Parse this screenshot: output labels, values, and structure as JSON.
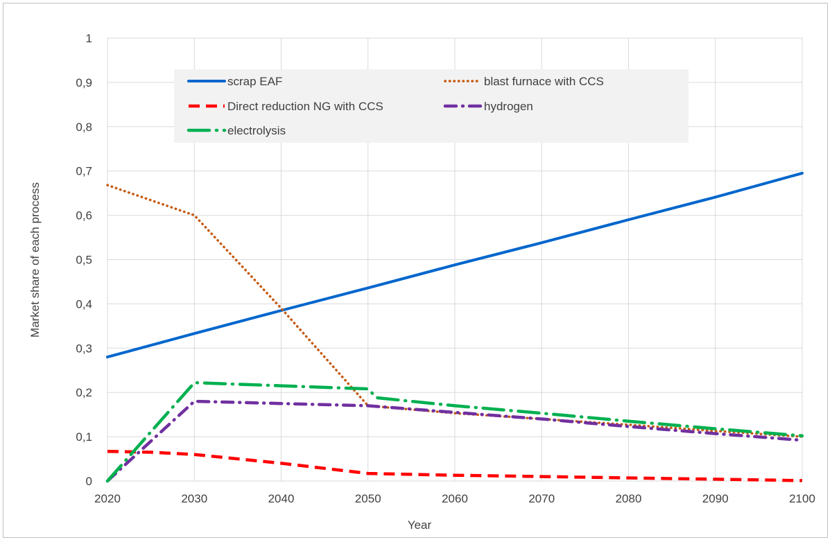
{
  "chart_data": {
    "type": "line",
    "title": "",
    "xlabel": "Year",
    "ylabel": "Market share of each process",
    "xlim": [
      2020,
      2100
    ],
    "ylim": [
      0,
      1
    ],
    "x_ticks": [
      "2020",
      "2030",
      "2040",
      "2050",
      "2060",
      "2070",
      "2080",
      "2090",
      "2100"
    ],
    "y_ticks": [
      "0",
      "0,1",
      "0,2",
      "0,3",
      "0,4",
      "0,5",
      "0,6",
      "0,7",
      "0,8",
      "0,9",
      "1"
    ],
    "grid": "vertical and horizontal",
    "legend_position": "top-left inside",
    "series": [
      {
        "name": "scrap EAF",
        "color": "#0066cc",
        "style": "solid",
        "points": [
          [
            2020,
            0.28
          ],
          [
            2030,
            0.333
          ],
          [
            2040,
            0.385
          ],
          [
            2050,
            0.436
          ],
          [
            2060,
            0.488
          ],
          [
            2070,
            0.538
          ],
          [
            2080,
            0.59
          ],
          [
            2090,
            0.641
          ],
          [
            2100,
            0.695
          ]
        ]
      },
      {
        "name": "blast furnace with CCS",
        "color": "#c55a11",
        "style": "dotted",
        "points": [
          [
            2020,
            0.668
          ],
          [
            2030,
            0.6
          ],
          [
            2040,
            0.39
          ],
          [
            2050,
            0.17
          ],
          [
            2060,
            0.153
          ],
          [
            2070,
            0.14
          ],
          [
            2080,
            0.127
          ],
          [
            2090,
            0.113
          ],
          [
            2100,
            0.1
          ]
        ]
      },
      {
        "name": "Direct reduction NG with CCS",
        "color": "#ff0000",
        "style": "dashed",
        "points": [
          [
            2020,
            0.067
          ],
          [
            2025,
            0.065
          ],
          [
            2030,
            0.06
          ],
          [
            2040,
            0.04
          ],
          [
            2050,
            0.017
          ],
          [
            2060,
            0.013
          ],
          [
            2070,
            0.01
          ],
          [
            2080,
            0.007
          ],
          [
            2090,
            0.004
          ],
          [
            2100,
            0.001
          ]
        ]
      },
      {
        "name": "hydrogen",
        "color": "#7030a0",
        "style": "dash-dot",
        "points": [
          [
            2020,
            0.0
          ],
          [
            2030,
            0.18
          ],
          [
            2040,
            0.175
          ],
          [
            2050,
            0.17
          ],
          [
            2060,
            0.155
          ],
          [
            2070,
            0.14
          ],
          [
            2080,
            0.123
          ],
          [
            2090,
            0.107
          ],
          [
            2100,
            0.092
          ]
        ]
      },
      {
        "name": "electrolysis",
        "color": "#00b050",
        "style": "long-dash-dot",
        "points": [
          [
            2020,
            0.0
          ],
          [
            2030,
            0.222
          ],
          [
            2040,
            0.215
          ],
          [
            2050,
            0.208
          ],
          [
            2051,
            0.188
          ],
          [
            2060,
            0.17
          ],
          [
            2070,
            0.153
          ],
          [
            2080,
            0.135
          ],
          [
            2090,
            0.118
          ],
          [
            2100,
            0.102
          ]
        ]
      }
    ]
  }
}
